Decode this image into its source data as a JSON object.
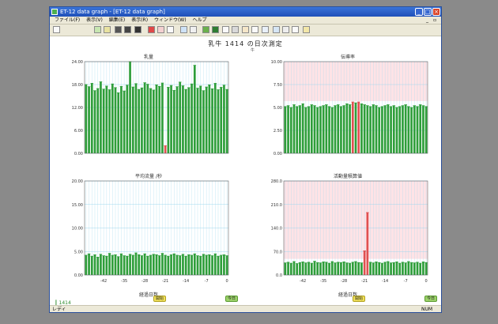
{
  "window": {
    "title": "ET-12 data graph - [ET-12 data graph]"
  },
  "menu": [
    "ファイル(F)",
    "表示(V)",
    "編集(E)",
    "表示(R)",
    "ウィンドウ(W)",
    "ヘルプ"
  ],
  "page_title": "乳牛 1414 の日次測定",
  "unit_label": "牛",
  "x_axis_label": "経過日数",
  "markers": {
    "event": "開始",
    "today": "今日"
  },
  "legend": "1414",
  "status": {
    "left": "レディ",
    "right": "NUM"
  },
  "colors": {
    "normal": "#2e9e3a",
    "alert": "#e05050",
    "grid": "#9fd8ee",
    "alert_bg": "#ffe3e6"
  },
  "chart_data": [
    {
      "type": "bar",
      "title": "乳量",
      "x": [
        -48,
        -47,
        -46,
        -45,
        -44,
        -43,
        -42,
        -41,
        -40,
        -39,
        -38,
        -37,
        -36,
        -35,
        -34,
        -33,
        -32,
        -31,
        -30,
        -29,
        -28,
        -27,
        -26,
        -25,
        -24,
        -23,
        -22,
        -21,
        -20,
        -19,
        -18,
        -17,
        -16,
        -15,
        -14,
        -13,
        -12,
        -11,
        -10,
        -9,
        -8,
        -7,
        -6,
        -5,
        -4,
        -3,
        -2,
        -1,
        0
      ],
      "values": [
        22.5,
        21.8,
        22.9,
        20.5,
        21.2,
        23.4,
        21.0,
        22.0,
        20.8,
        22.7,
        21.5,
        19.8,
        21.9,
        20.4,
        22.3,
        30.0,
        21.7,
        22.8,
        20.9,
        21.4,
        23.1,
        22.6,
        21.2,
        20.7,
        22.4,
        21.9,
        23.0,
        2.5,
        21.6,
        22.2,
        20.6,
        21.8,
        23.3,
        22.1,
        20.9,
        21.5,
        22.7,
        28.8,
        21.3,
        22.0,
        20.5,
        21.7,
        22.4,
        21.1,
        22.9,
        20.8,
        21.6,
        22.3,
        20.9
      ],
      "alert_index": 27,
      "ytick_labels": [
        "0.00",
        "6.00",
        "12.00",
        "18.00",
        "24.00"
      ],
      "ylim": [
        0,
        30
      ]
    },
    {
      "type": "bar",
      "title": "伝導率",
      "x": [
        -48,
        -47,
        -46,
        -45,
        -44,
        -43,
        -42,
        -41,
        -40,
        -39,
        -38,
        -37,
        -36,
        -35,
        -34,
        -33,
        -32,
        -31,
        -30,
        -29,
        -28,
        -27,
        -26,
        -25,
        -24,
        -23,
        -22,
        -21,
        -20,
        -19,
        -18,
        -17,
        -16,
        -15,
        -14,
        -13,
        -12,
        -11,
        -10,
        -9,
        -8,
        -7,
        -6,
        -5,
        -4,
        -3,
        -2,
        -1,
        0
      ],
      "values": [
        5.1,
        5.2,
        5.0,
        5.3,
        5.1,
        5.2,
        5.4,
        5.0,
        5.1,
        5.3,
        5.2,
        5.0,
        5.1,
        5.2,
        5.3,
        5.1,
        5.0,
        5.2,
        5.3,
        5.1,
        5.2,
        5.4,
        5.3,
        5.6,
        5.5,
        5.6,
        5.4,
        5.3,
        5.2,
        5.1,
        5.3,
        5.2,
        5.0,
        5.1,
        5.2,
        5.3,
        5.1,
        5.2,
        5.0,
        5.1,
        5.2,
        5.3,
        5.1,
        5.0,
        5.2,
        5.1,
        5.3,
        5.2,
        5.1
      ],
      "alert_indices": [
        23,
        25
      ],
      "ytick_labels": [
        "0.00",
        "2.50",
        "5.00",
        "7.50",
        "10.00"
      ],
      "ylim": [
        0,
        10
      ],
      "alert_threshold": 5.7
    },
    {
      "type": "bar",
      "title": "平均流量 /秒",
      "x": [
        -48,
        -47,
        -46,
        -45,
        -44,
        -43,
        -42,
        -41,
        -40,
        -39,
        -38,
        -37,
        -36,
        -35,
        -34,
        -33,
        -32,
        -31,
        -30,
        -29,
        -28,
        -27,
        -26,
        -25,
        -24,
        -23,
        -22,
        -21,
        -20,
        -19,
        -18,
        -17,
        -16,
        -15,
        -14,
        -13,
        -12,
        -11,
        -10,
        -9,
        -8,
        -7,
        -6,
        -5,
        -4,
        -3,
        -2,
        -1,
        0
      ],
      "values": [
        4.2,
        4.5,
        4.0,
        4.3,
        3.8,
        4.4,
        4.1,
        4.0,
        4.6,
        4.2,
        4.3,
        3.9,
        4.5,
        4.1,
        4.0,
        4.4,
        4.2,
        4.7,
        4.3,
        4.1,
        4.5,
        4.0,
        4.2,
        4.4,
        4.3,
        4.1,
        4.6,
        4.2,
        4.0,
        4.3,
        4.5,
        4.2,
        4.1,
        4.4,
        4.0,
        4.3,
        4.2,
        4.5,
        4.1,
        4.0,
        4.4,
        4.2,
        4.3,
        4.1,
        4.5,
        4.0,
        4.2,
        4.3,
        4.1
      ],
      "ytick_labels": [
        "0.00",
        "5.00",
        "10.00",
        "15.00",
        "20.00"
      ],
      "ylim": [
        0,
        20
      ]
    },
    {
      "type": "bar",
      "title": "活動量積算値",
      "x": [
        -48,
        -47,
        -46,
        -45,
        -44,
        -43,
        -42,
        -41,
        -40,
        -39,
        -38,
        -37,
        -36,
        -35,
        -34,
        -33,
        -32,
        -31,
        -30,
        -29,
        -28,
        -27,
        -26,
        -25,
        -24,
        -23,
        -22,
        -21,
        -20,
        -19,
        -18,
        -17,
        -16,
        -15,
        -14,
        -13,
        -12,
        -11,
        -10,
        -9,
        -8,
        -7,
        -6,
        -5,
        -4,
        -3,
        -2,
        -1,
        0
      ],
      "values": [
        36,
        38,
        35,
        40,
        34,
        37,
        39,
        36,
        38,
        35,
        41,
        37,
        36,
        39,
        38,
        35,
        40,
        36,
        38,
        37,
        39,
        36,
        35,
        38,
        40,
        37,
        36,
        72,
        186,
        38,
        36,
        39,
        37,
        35,
        38,
        40,
        36,
        37,
        39,
        35,
        38,
        36,
        40,
        37,
        36,
        38,
        35,
        39,
        37
      ],
      "alert_indices": [
        27,
        28
      ],
      "ytick_labels": [
        "0.0",
        "70.0",
        "140.0",
        "210.0",
        "280.0"
      ],
      "ylim": [
        0,
        280
      ],
      "alert_threshold": 48
    }
  ],
  "x_tick_labels": [
    "-42",
    "-35",
    "-28",
    "-21",
    "-14",
    "-7",
    "0"
  ]
}
